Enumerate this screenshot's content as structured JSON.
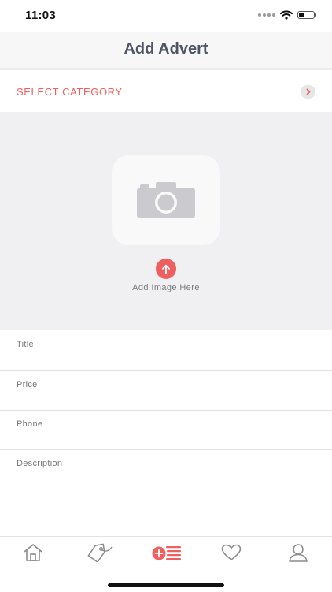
{
  "status_bar": {
    "time": "11:03",
    "battery_level": 0.35
  },
  "header": {
    "title": "Add Advert"
  },
  "category": {
    "label": "SELECT CATEGORY",
    "icon": "chevron-right-icon"
  },
  "image_upload": {
    "label": "Add Image Here",
    "placeholder_icon": "camera-icon",
    "button_icon": "upload-arrow-icon"
  },
  "form": {
    "fields": [
      {
        "label": "Title"
      },
      {
        "label": "Price"
      },
      {
        "label": "Phone"
      },
      {
        "label": "Description"
      }
    ]
  },
  "tab_bar": {
    "tabs": [
      {
        "name": "home",
        "icon": "home-icon",
        "active": false
      },
      {
        "name": "tags",
        "icon": "tag-icon",
        "active": false
      },
      {
        "name": "add-advert",
        "icon": "add-list-icon",
        "active": true
      },
      {
        "name": "favorites",
        "icon": "heart-icon",
        "active": false
      },
      {
        "name": "profile",
        "icon": "user-icon",
        "active": false
      }
    ]
  },
  "colors": {
    "accent": "#ef5f60",
    "title": "#4e5563",
    "icon_gray": "#8a8a8a",
    "background_gray": "#f0f0f2"
  }
}
